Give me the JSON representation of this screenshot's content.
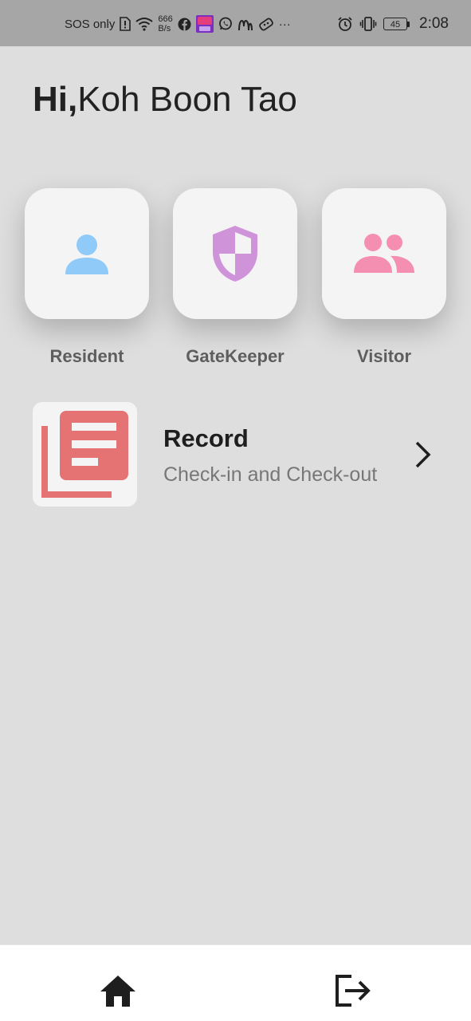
{
  "status_bar": {
    "carrier": "SOS only",
    "speed_value": "666",
    "speed_unit": "B/s",
    "more": "···",
    "battery": "45",
    "time": "2:08"
  },
  "greeting": {
    "prefix": "Hi,",
    "name": "Koh Boon Tao"
  },
  "roles": [
    {
      "label": "Resident",
      "icon": "person-icon",
      "color": "#90caf9"
    },
    {
      "label": "GateKeeper",
      "icon": "shield-icon",
      "color": "#ce93d8"
    },
    {
      "label": "Visitor",
      "icon": "people-icon",
      "color": "#f48fb1"
    }
  ],
  "record": {
    "title": "Record",
    "subtitle": "Check-in and Check-out",
    "icon": "library-books-icon",
    "icon_color": "#e57373"
  },
  "bottom_nav": {
    "items": [
      {
        "icon": "home-icon"
      },
      {
        "icon": "logout-icon"
      }
    ]
  }
}
